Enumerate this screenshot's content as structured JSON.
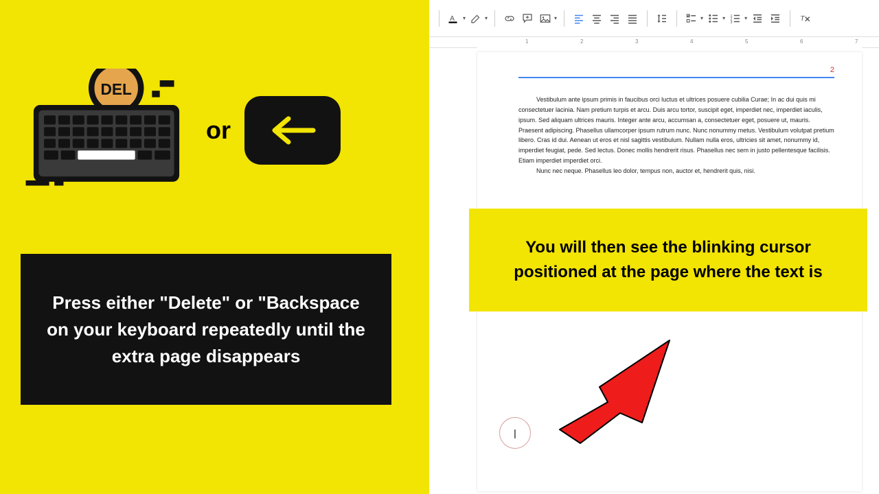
{
  "left": {
    "del_label": "DEL",
    "or_label": "or",
    "instruction": "Press either \"Delete\" or \"Backspace on your keyboard repeatedly until the extra page disappears"
  },
  "right": {
    "toolbar": {
      "icons": [
        "hyperlink",
        "comment",
        "image",
        "align-left",
        "align-center",
        "align-right",
        "align-justify",
        "line-spacing",
        "checklist",
        "bullet-list",
        "number-list",
        "indent-decrease",
        "indent-increase",
        "clear-format"
      ]
    },
    "ruler_numbers": [
      "1",
      "2",
      "3",
      "4",
      "5",
      "6",
      "7"
    ],
    "page_number": "2",
    "paragraph1": "Vestibulum ante ipsum primis in faucibus orci luctus et ultrices posuere cubilia Curae; In ac dui quis mi consectetuer lacinia. Nam pretium turpis et arcu. Duis arcu tortor, suscipit eget, imperdiet nec, imperdiet iaculis, ipsum. Sed aliquam ultrices mauris. Integer ante arcu, accumsan a, consectetuer eget, posuere ut, mauris. Praesent adipiscing. Phasellus ullamcorper ipsum rutrum nunc. Nunc nonummy metus. Vestibulum volutpat pretium libero. Cras id dui. Aenean ut eros et nisl sagittis vestibulum. Nullam nulla eros, ultricies sit amet, nonummy id, imperdiet feugiat, pede. Sed lectus. Donec mollis hendrerit risus. Phasellus nec sem in justo pellentesque facilisis. Etiam imperdiet imperdiet orci.",
    "paragraph2": "Nunc nec neque. Phasellus leo dolor, tempus non, auctor et, hendrerit quis, nisi.",
    "callout": "You will then see the blinking cursor positioned at the page where the text is",
    "cursor_char": "|"
  }
}
